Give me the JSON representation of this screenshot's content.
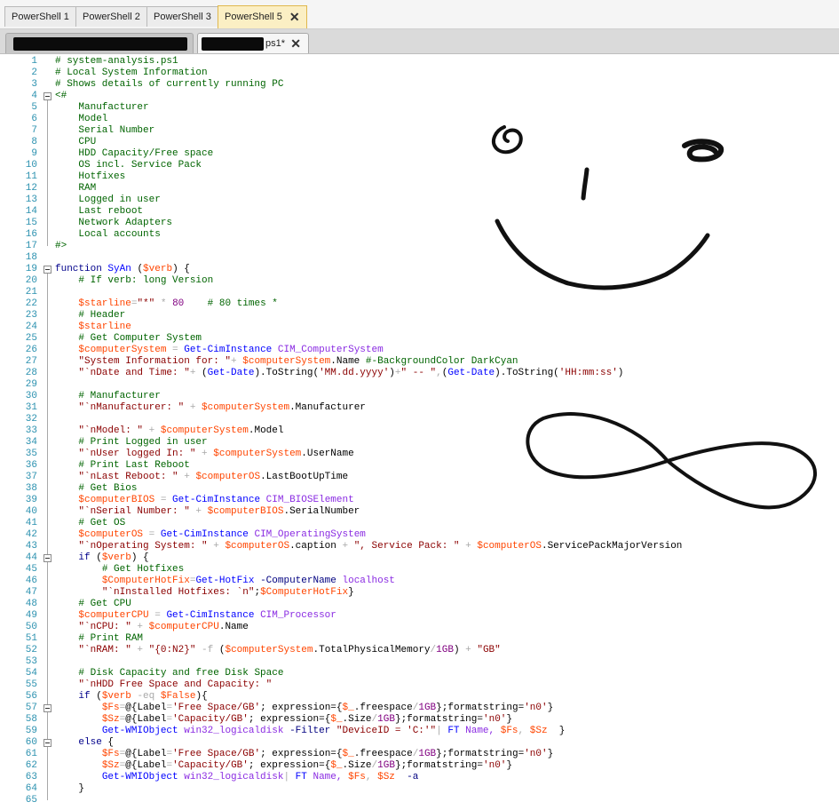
{
  "session_tabs": [
    {
      "label": "PowerShell 1",
      "active": false
    },
    {
      "label": "PowerShell 2",
      "active": false
    },
    {
      "label": "PowerShell 3",
      "active": false
    },
    {
      "label": "PowerShell 5",
      "active": true
    }
  ],
  "file_tabs": [
    {
      "label": "",
      "active": false,
      "redacted": true
    },
    {
      "label": "ps1*",
      "active": true,
      "redacted": true
    }
  ],
  "colors": {
    "comment": "#006400",
    "string": "#8b0000",
    "keyword": "#00008b",
    "command": "#0000ff",
    "variable": "#ff4500",
    "argument": "#8a2be2",
    "line_number": "#2b91af",
    "active_tab": "#fbefc4"
  },
  "icons": {
    "close": "close-icon",
    "fold": "fold-toggle-icon"
  },
  "editor": {
    "lines": [
      [
        [
          "# system-analysis.ps1",
          "c"
        ]
      ],
      [
        [
          "# Local System Information",
          "c"
        ]
      ],
      [
        [
          "# Shows details of currently running PC",
          "c"
        ]
      ],
      [
        [
          "<#",
          "c"
        ]
      ],
      [
        [
          "    Manufacturer",
          "c"
        ]
      ],
      [
        [
          "    Model",
          "c"
        ]
      ],
      [
        [
          "    Serial Number",
          "c"
        ]
      ],
      [
        [
          "    CPU",
          "c"
        ]
      ],
      [
        [
          "    HDD Capacity/Free space",
          "c"
        ]
      ],
      [
        [
          "    OS incl. Service Pack",
          "c"
        ]
      ],
      [
        [
          "    Hotfixes",
          "c"
        ]
      ],
      [
        [
          "    RAM",
          "c"
        ]
      ],
      [
        [
          "    Logged in user",
          "c"
        ]
      ],
      [
        [
          "    Last reboot",
          "c"
        ]
      ],
      [
        [
          "    Network Adapters",
          "c"
        ]
      ],
      [
        [
          "    Local accounts",
          "c"
        ]
      ],
      [
        [
          "#>",
          "c"
        ]
      ],
      [],
      [
        [
          "function ",
          "k"
        ],
        [
          "SyAn ",
          "f"
        ],
        [
          "(",
          "p"
        ],
        [
          "$verb",
          "v"
        ],
        [
          ") {",
          "p"
        ]
      ],
      [
        [
          "    ",
          "p"
        ],
        [
          "# If verb: long Version",
          "c"
        ]
      ],
      [],
      [
        [
          "    ",
          "p"
        ],
        [
          "$starline",
          "v"
        ],
        [
          "=",
          "o"
        ],
        [
          "\"*\"",
          "s"
        ],
        [
          " * ",
          "o"
        ],
        [
          "80",
          "n"
        ],
        [
          "    ",
          "p"
        ],
        [
          "# 80 times *",
          "c"
        ]
      ],
      [
        [
          "    ",
          "p"
        ],
        [
          "# Header",
          "c"
        ]
      ],
      [
        [
          "    ",
          "p"
        ],
        [
          "$starline",
          "v"
        ]
      ],
      [
        [
          "    ",
          "p"
        ],
        [
          "# Get Computer System",
          "c"
        ]
      ],
      [
        [
          "    ",
          "p"
        ],
        [
          "$computerSystem",
          "v"
        ],
        [
          " = ",
          "o"
        ],
        [
          "Get-CimInstance",
          "f"
        ],
        [
          " CIM_ComputerSystem",
          "a"
        ]
      ],
      [
        [
          "    ",
          "p"
        ],
        [
          "\"System Information for: \"",
          "s"
        ],
        [
          "+ ",
          "o"
        ],
        [
          "$computerSystem",
          "v"
        ],
        [
          ".Name ",
          "p"
        ],
        [
          "#-BackgroundColor DarkCyan",
          "c"
        ]
      ],
      [
        [
          "    ",
          "p"
        ],
        [
          "\"`nDate and Time: \"",
          "s"
        ],
        [
          "+ ",
          "o"
        ],
        [
          "(",
          "p"
        ],
        [
          "Get-Date",
          "f"
        ],
        [
          ").ToString(",
          "p"
        ],
        [
          "'MM.dd.yyyy'",
          "s"
        ],
        [
          ")",
          "p"
        ],
        [
          "+",
          "o"
        ],
        [
          "\" -- \"",
          "s"
        ],
        [
          ",",
          "o"
        ],
        [
          "(",
          "p"
        ],
        [
          "Get-Date",
          "f"
        ],
        [
          ").ToString(",
          "p"
        ],
        [
          "'HH:mm:ss'",
          "s"
        ],
        [
          ")",
          "p"
        ]
      ],
      [],
      [
        [
          "    ",
          "p"
        ],
        [
          "# Manufacturer",
          "c"
        ]
      ],
      [
        [
          "    ",
          "p"
        ],
        [
          "\"`nManufacturer: \"",
          "s"
        ],
        [
          " + ",
          "o"
        ],
        [
          "$computerSystem",
          "v"
        ],
        [
          ".Manufacturer",
          "p"
        ]
      ],
      [],
      [
        [
          "    ",
          "p"
        ],
        [
          "\"`nModel: \"",
          "s"
        ],
        [
          " + ",
          "o"
        ],
        [
          "$computerSystem",
          "v"
        ],
        [
          ".Model",
          "p"
        ]
      ],
      [
        [
          "    ",
          "p"
        ],
        [
          "# Print Logged in user",
          "c"
        ]
      ],
      [
        [
          "    ",
          "p"
        ],
        [
          "\"`nUser logged In: \"",
          "s"
        ],
        [
          " + ",
          "o"
        ],
        [
          "$computerSystem",
          "v"
        ],
        [
          ".UserName",
          "p"
        ]
      ],
      [
        [
          "    ",
          "p"
        ],
        [
          "# Print Last Reboot",
          "c"
        ]
      ],
      [
        [
          "    ",
          "p"
        ],
        [
          "\"`nLast Reboot: \"",
          "s"
        ],
        [
          " + ",
          "o"
        ],
        [
          "$computerOS",
          "v"
        ],
        [
          ".LastBootUpTime",
          "p"
        ]
      ],
      [
        [
          "    ",
          "p"
        ],
        [
          "# Get Bios",
          "c"
        ]
      ],
      [
        [
          "    ",
          "p"
        ],
        [
          "$computerBIOS",
          "v"
        ],
        [
          " = ",
          "o"
        ],
        [
          "Get-CimInstance",
          "f"
        ],
        [
          " CIM_BIOSElement",
          "a"
        ]
      ],
      [
        [
          "    ",
          "p"
        ],
        [
          "\"`nSerial Number: \"",
          "s"
        ],
        [
          " + ",
          "o"
        ],
        [
          "$computerBIOS",
          "v"
        ],
        [
          ".SerialNumber",
          "p"
        ]
      ],
      [
        [
          "    ",
          "p"
        ],
        [
          "# Get OS",
          "c"
        ]
      ],
      [
        [
          "    ",
          "p"
        ],
        [
          "$computerOS",
          "v"
        ],
        [
          " = ",
          "o"
        ],
        [
          "Get-CimInstance",
          "f"
        ],
        [
          " CIM_OperatingSystem",
          "a"
        ]
      ],
      [
        [
          "    ",
          "p"
        ],
        [
          "\"`nOperating System: \"",
          "s"
        ],
        [
          " + ",
          "o"
        ],
        [
          "$computerOS",
          "v"
        ],
        [
          ".caption ",
          "p"
        ],
        [
          "+ ",
          "o"
        ],
        [
          "\", Service Pack: \"",
          "s"
        ],
        [
          " + ",
          "o"
        ],
        [
          "$computerOS",
          "v"
        ],
        [
          ".ServicePackMajorVersion",
          "p"
        ]
      ],
      [
        [
          "    ",
          "p"
        ],
        [
          "if ",
          "k"
        ],
        [
          "(",
          "p"
        ],
        [
          "$verb",
          "v"
        ],
        [
          ") {",
          "p"
        ]
      ],
      [
        [
          "        ",
          "p"
        ],
        [
          "# Get Hotfixes",
          "c"
        ]
      ],
      [
        [
          "        ",
          "p"
        ],
        [
          "$ComputerHotFix",
          "v"
        ],
        [
          "=",
          "o"
        ],
        [
          "Get-HotFix",
          "f"
        ],
        [
          " -ComputerName",
          "m"
        ],
        [
          " localhost",
          "a"
        ]
      ],
      [
        [
          "        ",
          "p"
        ],
        [
          "\"`nInstalled Hotfixes: `n\"",
          "s"
        ],
        [
          ";",
          "p"
        ],
        [
          "$ComputerHotFix",
          "v"
        ],
        [
          "}",
          "p"
        ]
      ],
      [
        [
          "    ",
          "p"
        ],
        [
          "# Get CPU",
          "c"
        ]
      ],
      [
        [
          "    ",
          "p"
        ],
        [
          "$computerCPU",
          "v"
        ],
        [
          " = ",
          "o"
        ],
        [
          "Get-CimInstance",
          "f"
        ],
        [
          " CIM_Processor",
          "a"
        ]
      ],
      [
        [
          "    ",
          "p"
        ],
        [
          "\"`nCPU: \"",
          "s"
        ],
        [
          " + ",
          "o"
        ],
        [
          "$computerCPU",
          "v"
        ],
        [
          ".Name",
          "p"
        ]
      ],
      [
        [
          "    ",
          "p"
        ],
        [
          "# Print RAM",
          "c"
        ]
      ],
      [
        [
          "    ",
          "p"
        ],
        [
          "\"`nRAM: \"",
          "s"
        ],
        [
          " + ",
          "o"
        ],
        [
          "\"{0:N2}\"",
          "s"
        ],
        [
          " -f ",
          "o"
        ],
        [
          "(",
          "p"
        ],
        [
          "$computerSystem",
          "v"
        ],
        [
          ".TotalPhysicalMemory",
          "p"
        ],
        [
          "/",
          "o"
        ],
        [
          "1GB",
          "n"
        ],
        [
          ") ",
          "p"
        ],
        [
          "+ ",
          "o"
        ],
        [
          "\"GB\"",
          "s"
        ]
      ],
      [],
      [
        [
          "    ",
          "p"
        ],
        [
          "# Disk Capacity and free Disk Space",
          "c"
        ]
      ],
      [
        [
          "    ",
          "p"
        ],
        [
          "\"`nHDD Free Space and Capacity: \"",
          "s"
        ]
      ],
      [
        [
          "    ",
          "p"
        ],
        [
          "if ",
          "k"
        ],
        [
          "(",
          "p"
        ],
        [
          "$verb",
          "v"
        ],
        [
          " -eq ",
          "o"
        ],
        [
          "$False",
          "v"
        ],
        [
          "){",
          "p"
        ]
      ],
      [
        [
          "        ",
          "p"
        ],
        [
          "$Fs",
          "v"
        ],
        [
          "=",
          "o"
        ],
        [
          "@{",
          "p"
        ],
        [
          "Label",
          "p"
        ],
        [
          "=",
          "o"
        ],
        [
          "'Free Space/GB'",
          "s"
        ],
        [
          "; expression=",
          "p"
        ],
        [
          "{",
          "p"
        ],
        [
          "$_",
          "v"
        ],
        [
          ".freespace",
          "p"
        ],
        [
          "/",
          "o"
        ],
        [
          "1GB",
          "n"
        ],
        [
          "};formatstring=",
          "p"
        ],
        [
          "'n0'",
          "s"
        ],
        [
          "}",
          "p"
        ]
      ],
      [
        [
          "        ",
          "p"
        ],
        [
          "$Sz",
          "v"
        ],
        [
          "=",
          "o"
        ],
        [
          "@{",
          "p"
        ],
        [
          "Label",
          "p"
        ],
        [
          "=",
          "o"
        ],
        [
          "'Capacity/GB'",
          "s"
        ],
        [
          "; expression=",
          "p"
        ],
        [
          "{",
          "p"
        ],
        [
          "$_",
          "v"
        ],
        [
          ".Size",
          "p"
        ],
        [
          "/",
          "o"
        ],
        [
          "1GB",
          "n"
        ],
        [
          "};formatstring=",
          "p"
        ],
        [
          "'n0'",
          "s"
        ],
        [
          "}",
          "p"
        ]
      ],
      [
        [
          "        ",
          "p"
        ],
        [
          "Get-WMIObject",
          "f"
        ],
        [
          " win32_logicaldisk",
          "a"
        ],
        [
          " -Filter",
          "m"
        ],
        [
          " \"DeviceID = 'C:'\"",
          "s"
        ],
        [
          "| ",
          "o"
        ],
        [
          "FT",
          "f"
        ],
        [
          " Name, ",
          "a"
        ],
        [
          "$Fs",
          "v"
        ],
        [
          ", ",
          "o"
        ],
        [
          "$Sz",
          "v"
        ],
        [
          "  }",
          "p"
        ]
      ],
      [
        [
          "    ",
          "p"
        ],
        [
          "else ",
          "k"
        ],
        [
          "{",
          "p"
        ]
      ],
      [
        [
          "        ",
          "p"
        ],
        [
          "$Fs",
          "v"
        ],
        [
          "=",
          "o"
        ],
        [
          "@{",
          "p"
        ],
        [
          "Label",
          "p"
        ],
        [
          "=",
          "o"
        ],
        [
          "'Free Space/GB'",
          "s"
        ],
        [
          "; expression=",
          "p"
        ],
        [
          "{",
          "p"
        ],
        [
          "$_",
          "v"
        ],
        [
          ".freespace",
          "p"
        ],
        [
          "/",
          "o"
        ],
        [
          "1GB",
          "n"
        ],
        [
          "};formatstring=",
          "p"
        ],
        [
          "'n0'",
          "s"
        ],
        [
          "}",
          "p"
        ]
      ],
      [
        [
          "        ",
          "p"
        ],
        [
          "$Sz",
          "v"
        ],
        [
          "=",
          "o"
        ],
        [
          "@{",
          "p"
        ],
        [
          "Label",
          "p"
        ],
        [
          "=",
          "o"
        ],
        [
          "'Capacity/GB'",
          "s"
        ],
        [
          "; expression=",
          "p"
        ],
        [
          "{",
          "p"
        ],
        [
          "$_",
          "v"
        ],
        [
          ".Size",
          "p"
        ],
        [
          "/",
          "o"
        ],
        [
          "1GB",
          "n"
        ],
        [
          "};formatstring=",
          "p"
        ],
        [
          "'n0'",
          "s"
        ],
        [
          "}",
          "p"
        ]
      ],
      [
        [
          "        ",
          "p"
        ],
        [
          "Get-WMIObject",
          "f"
        ],
        [
          " win32_logicaldisk",
          "a"
        ],
        [
          "| ",
          "o"
        ],
        [
          "FT",
          "f"
        ],
        [
          " Name, ",
          "a"
        ],
        [
          "$Fs",
          "v"
        ],
        [
          ", ",
          "o"
        ],
        [
          "$Sz",
          "v"
        ],
        [
          "  -a",
          "m"
        ]
      ],
      [
        [
          "    }",
          "p"
        ]
      ],
      []
    ]
  }
}
